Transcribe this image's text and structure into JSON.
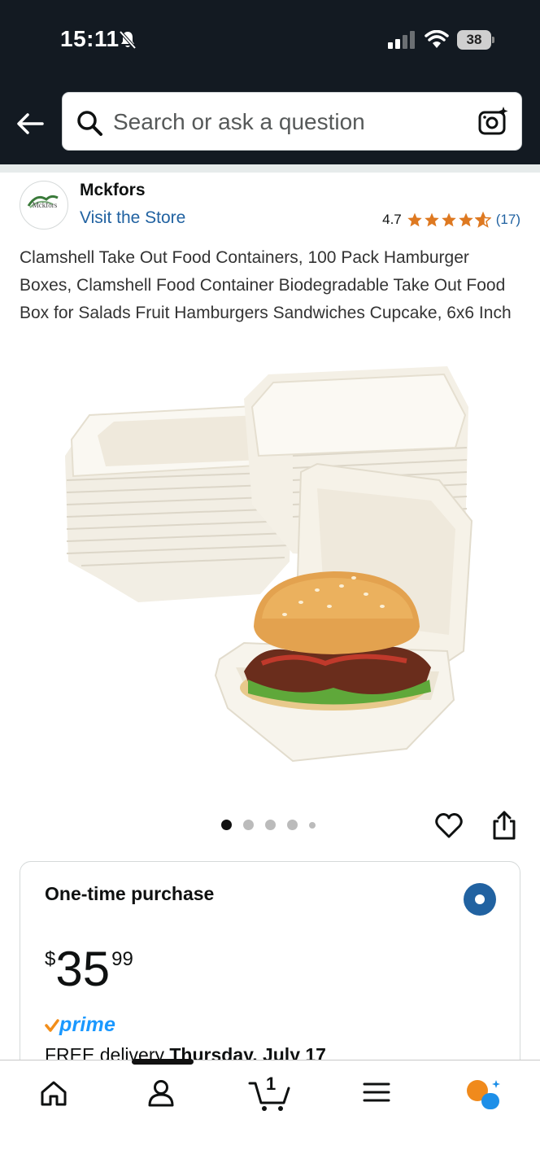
{
  "status_bar": {
    "time": "15:11",
    "battery": "38"
  },
  "search": {
    "placeholder": "Search or ask a question"
  },
  "brand": {
    "logo_text": "Mckfors",
    "name": "Mckfors",
    "visit_store": "Visit the Store",
    "rating_value": "4.7",
    "rating_count": "(17)",
    "stars": 4.7
  },
  "product": {
    "title": "Clamshell Take Out Food Containers, 100 Pack Hamburger Boxes, Clamshell Food Container Biodegradable Take Out Food Box for Salads Fruit Hamburgers Sandwiches Cupcake, 6x6 Inch",
    "image_count": 5,
    "active_image": 1
  },
  "buybox": {
    "option_label": "One-time purchase",
    "price_symbol": "$",
    "price_whole": "35",
    "price_fraction": "99",
    "prime_label": "prime",
    "delivery_prefix": "FREE delivery ",
    "delivery_date": "Thursday, July 17"
  },
  "nav": {
    "cart_count": "1"
  },
  "colors": {
    "header_bg": "#131a22",
    "link": "#2162a1",
    "star": "#de7921",
    "prime_blue": "#1a98ff",
    "prime_check": "#f28e1a",
    "radio": "#2162a1"
  }
}
